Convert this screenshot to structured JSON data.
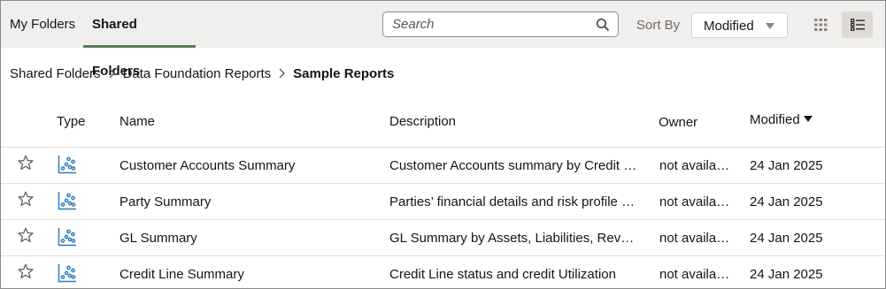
{
  "tabs": [
    {
      "label": "My Folders"
    },
    {
      "label": "Shared Folders"
    }
  ],
  "search": {
    "placeholder": "Search",
    "value": ""
  },
  "sort": {
    "label": "Sort By",
    "value": "Modified"
  },
  "breadcrumb": {
    "items": [
      "Shared Folders",
      "Data Foundation Reports"
    ],
    "current": "Sample Reports"
  },
  "table": {
    "headers": {
      "type": "Type",
      "name": "Name",
      "description": "Description",
      "owner": "Owner",
      "modified": "Modified"
    },
    "rows": [
      {
        "name": "Customer Accounts Summary",
        "description": "Customer Accounts summary by Credit Line",
        "owner": "not available",
        "modified": "24 Jan 2025"
      },
      {
        "name": "Party Summary",
        "description": "Parties’ financial details and risk profile summary",
        "owner": "not available",
        "modified": "24 Jan 2025"
      },
      {
        "name": "GL Summary",
        "description": "GL Summary by Assets, Liabilities, Revenue",
        "owner": "not available",
        "modified": "24 Jan 2025"
      },
      {
        "name": "Credit Line Summary",
        "description": "Credit Line status and credit Utilization",
        "owner": "not available",
        "modified": "24 Jan 2025"
      }
    ]
  },
  "icons": {
    "search": "search-icon",
    "grid_view": "grid-view-icon",
    "list_view": "list-view-icon",
    "favorite": "star-icon",
    "report": "scatter-chart-icon",
    "separator": "chevron-right-icon"
  },
  "colors": {
    "accent": "#5a7b55",
    "icon_blue": "#2f7fb8",
    "topbar_bg": "#f1efed"
  }
}
